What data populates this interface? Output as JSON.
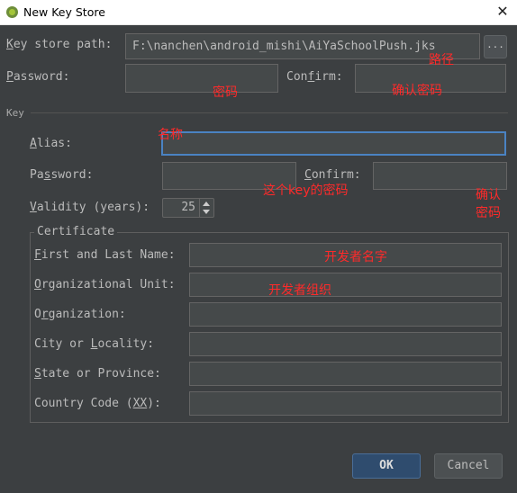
{
  "window": {
    "title": "New Key Store",
    "close_glyph": "✕"
  },
  "keystore": {
    "path_label_a": "K",
    "path_label_b": "ey store path:",
    "path_value": "F:\\nanchen\\android_mishi\\AiYaSchoolPush.jks",
    "browse_label": "...",
    "password_label_a": "P",
    "password_label_b": "assword:",
    "confirm_label_a": "Con",
    "confirm_label_b": "f",
    "confirm_label_c": "irm:"
  },
  "key": {
    "section_label": "Key",
    "alias_label_a": "A",
    "alias_label_b": "lias:",
    "password_label_a": "Pa",
    "password_label_b": "s",
    "password_label_c": "sword:",
    "confirm_label_a": "C",
    "confirm_label_b": "onfirm:",
    "validity_label_a": "V",
    "validity_label_b": "alidity (years):",
    "validity_value": "25"
  },
  "certificate": {
    "title": "Certificate",
    "first_last_a": "F",
    "first_last_b": "irst and Last Name:",
    "org_unit_a": "O",
    "org_unit_b": "rganizational Unit:",
    "org_a": "O",
    "org_b": "r",
    "org_c": "ganization:",
    "city_a": "City or ",
    "city_b": "L",
    "city_c": "ocality:",
    "state_a": "S",
    "state_b": "tate or Province:",
    "country_a": "Country Code (",
    "country_b": "XX",
    "country_c": "):"
  },
  "buttons": {
    "ok": "OK",
    "cancel": "Cancel"
  },
  "annotations": {
    "path": "路径",
    "password": "密码",
    "confirm": "确认密码",
    "alias": "名称",
    "key_password": "这个key的密码",
    "key_confirm_1": "确认",
    "key_confirm_2": "密码",
    "dev_name": "开发者名字",
    "dev_org": "开发者组织"
  },
  "colors": {
    "annotation": "#ff2a2a",
    "focus_border": "#4a83c3",
    "dialog_bg": "#3c3f41"
  }
}
